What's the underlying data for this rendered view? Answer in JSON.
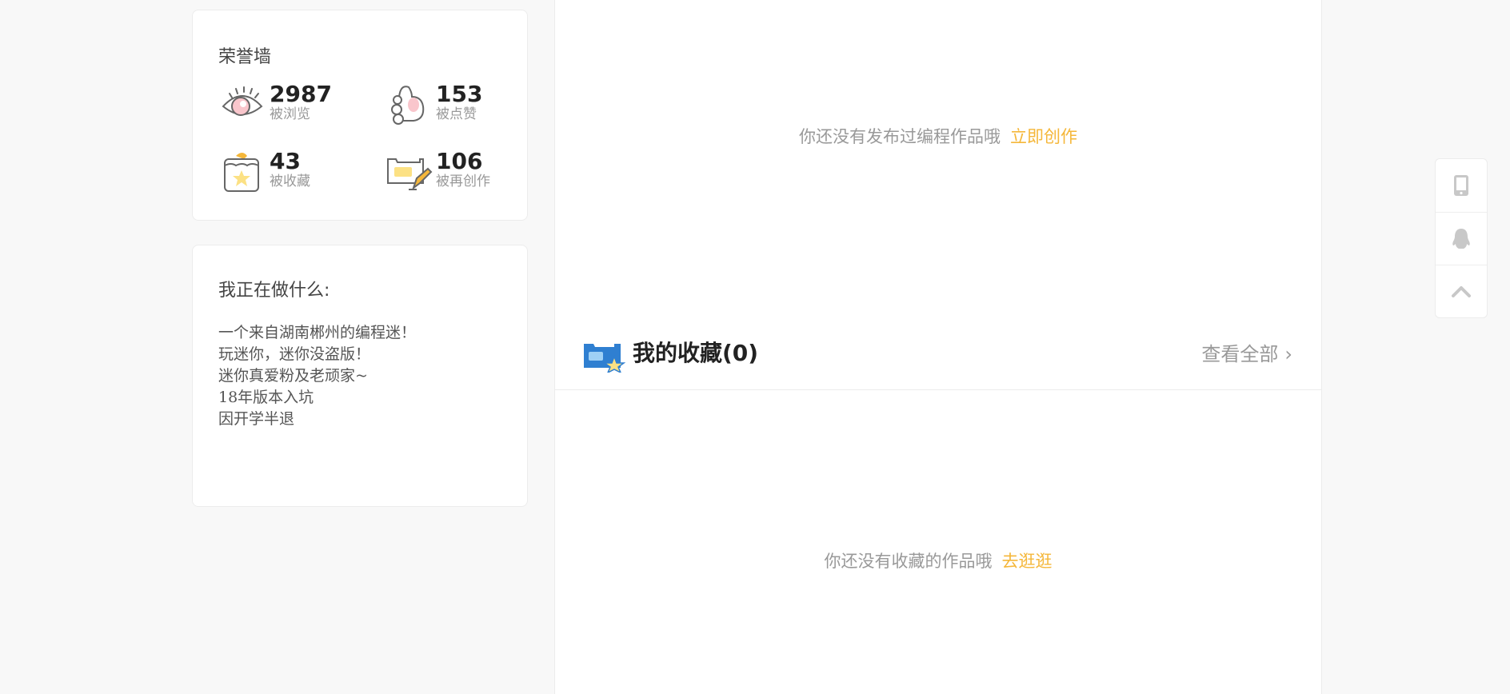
{
  "honor": {
    "title": "荣誉墙",
    "stats": [
      {
        "icon": "eye-icon",
        "value": "2987",
        "label": "被浏览"
      },
      {
        "icon": "like-icon",
        "value": "153",
        "label": "被点赞"
      },
      {
        "icon": "favorite-box-icon",
        "value": "43",
        "label": "被收藏"
      },
      {
        "icon": "recreate-icon",
        "value": "106",
        "label": "被再创作"
      }
    ]
  },
  "doing": {
    "title": "我正在做什么:",
    "lines": [
      "一个来自湖南郴州的编程迷！",
      "玩迷你，迷你没盗版！",
      "迷你真爱粉及老顽家~",
      "18年版本入坑",
      "因开学半退"
    ]
  },
  "works": {
    "empty_text": "你还没有发布过编程作品哦",
    "link_text": "立即创作"
  },
  "favorites": {
    "title": "我的收藏(0)",
    "view_all": "查看全部",
    "empty_text": "你还没有收藏的作品哦",
    "link_text": "去逛逛"
  },
  "side_tools": [
    "tablet-icon",
    "qq-penguin-icon",
    "back-to-top-icon"
  ],
  "colors": {
    "accent": "#f5b73a",
    "muted_text": "#999999",
    "background": "#f8f8f8"
  }
}
